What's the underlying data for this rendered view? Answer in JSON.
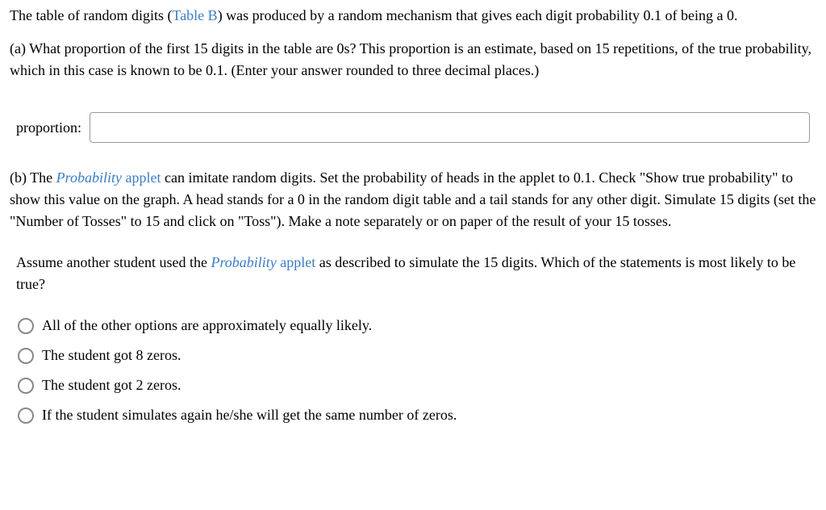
{
  "intro": {
    "prefix": "The table of random digits (",
    "link": "Table B",
    "suffix": ") was produced by a random mechanism that gives each digit probability 0.1 of being a 0."
  },
  "partA": "(a) What proportion of the first 15 digits in the table are 0s? This proportion is an estimate, based on 15 repetitions, of the true probability, which in this case is known to be 0.1. (Enter your answer rounded to three decimal places.)",
  "inputLabel": "proportion:",
  "inputValue": "",
  "partB": {
    "prefix": "(b) The ",
    "linkItalic": "Probability",
    "linkRest": " applet",
    "suffix": " can imitate random digits. Set the probability of heads in the applet to 0.1. Check \"Show true probability\" to show this value on the graph. A head stands for a 0 in the random digit table and a tail stands for any other digit. Simulate 15 digits (set the \"Number of Tosses\" to 15 and click on \"Toss\"). Make a note separately or on paper of the result of your 15 tosses."
  },
  "subQuestion": {
    "prefix": "Assume another student used the ",
    "linkItalic": "Probability",
    "linkRest": " applet",
    "suffix": " as described to simulate the 15 digits. Which of the statements is most likely to be true?"
  },
  "options": [
    "All of the other options are approximately equally likely.",
    "The student got 8 zeros.",
    "The student got 2 zeros.",
    "If the student simulates again he/she will get the same number of zeros."
  ]
}
